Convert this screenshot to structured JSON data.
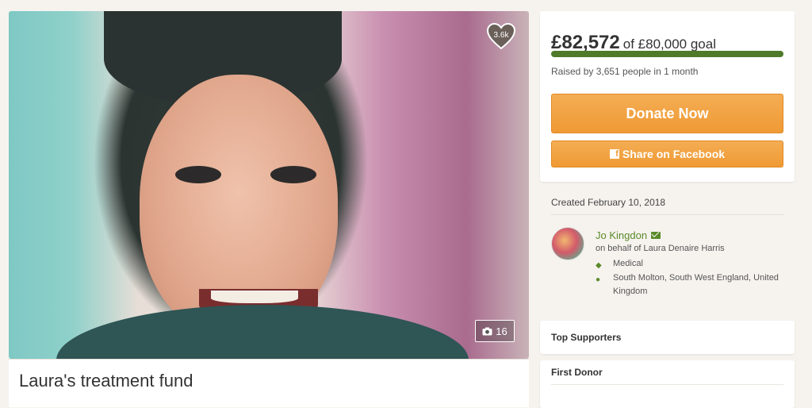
{
  "campaign": {
    "title": "Laura's treatment fund",
    "photo_count": "16",
    "likes": "3.6k"
  },
  "donation": {
    "amount": "£82,572",
    "goal_text": "of £80,000 goal",
    "progress_fraction": 1.0,
    "raised_text": "Raised by 3,651 people in 1 month",
    "donate_label": "Donate Now",
    "share_label": "Share on Facebook"
  },
  "details": {
    "created": "Created February 10, 2018",
    "organizer": "Jo Kingdon",
    "on_behalf": "on behalf of Laura Denaire Harris",
    "category": "Medical",
    "location": "South Molton, South West England, United Kingdom"
  },
  "sections": {
    "top_supporters": "Top Supporters",
    "first_donor": "First Donor"
  },
  "colors": {
    "accent": "#ef9a34",
    "progress": "#4e7a2a",
    "link": "#5a8a2a"
  },
  "icons": [
    "heart-icon",
    "camera-icon",
    "facebook-icon",
    "mail-icon",
    "tag-icon",
    "map-pin-icon"
  ]
}
